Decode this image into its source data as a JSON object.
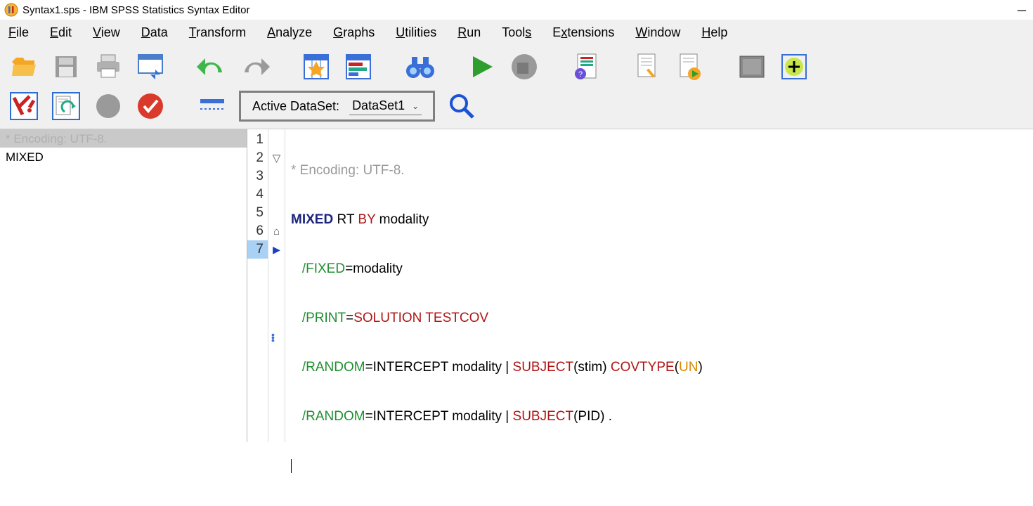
{
  "window": {
    "title": "Syntax1.sps - IBM SPSS Statistics Syntax Editor"
  },
  "menu": {
    "file": "File",
    "edit": "Edit",
    "view": "View",
    "data": "Data",
    "transform": "Transform",
    "analyze": "Analyze",
    "graphs": "Graphs",
    "utilities": "Utilities",
    "run": "Run",
    "tools": "Tools",
    "extensions": "Extensions",
    "window_m": "Window",
    "help": "Help"
  },
  "toolbar": {
    "active_dataset_label": "Active DataSet:",
    "active_dataset_value": "DataSet1"
  },
  "nav": {
    "header": "* Encoding: UTF-8.",
    "items": [
      "MIXED"
    ]
  },
  "gutter": [
    "1",
    "2",
    "3",
    "4",
    "5",
    "6",
    "7"
  ],
  "code": {
    "l1_comment": "* Encoding: UTF-8.",
    "l2_cmd": "MIXED",
    "l2_rt": " RT ",
    "l2_by": "BY",
    "l2_mod": " modality",
    "l3_sub": "/FIXED",
    "l3_rest": "=modality",
    "l4_sub": "/PRINT",
    "l4_eq": "=",
    "l4_kw": "SOLUTION TESTCOV",
    "l5_sub": "/RANDOM",
    "l5_mid": "=INTERCEPT modality | ",
    "l5_subj": "SUBJECT",
    "l5_p1": "(stim) ",
    "l5_cov": "COVTYPE",
    "l5_p2": "(",
    "l5_un": "UN",
    "l5_p3": ")",
    "l6_sub": "/RANDOM",
    "l6_mid": "=INTERCEPT modality | ",
    "l6_subj": "SUBJECT",
    "l6_end": "(PID) ."
  }
}
